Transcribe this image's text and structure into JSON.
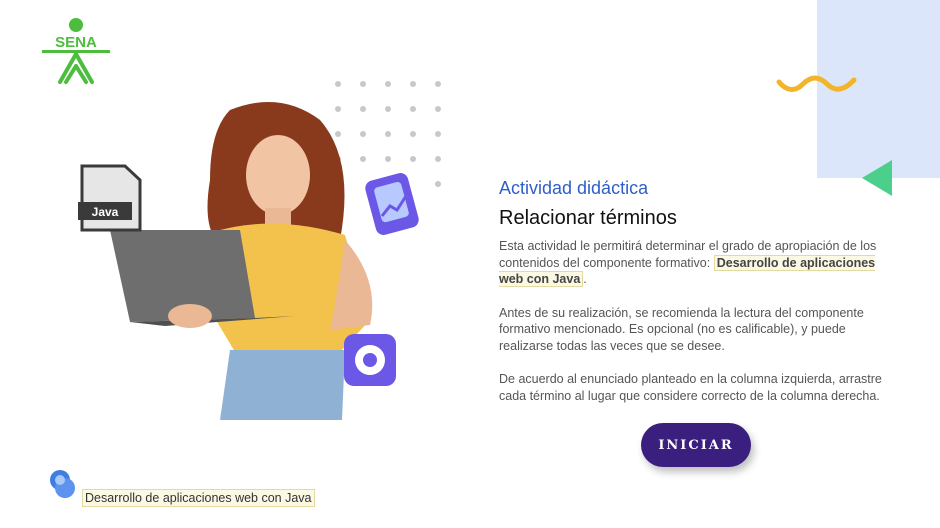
{
  "logo": {
    "text": "SENA",
    "color": "#4dbd3e"
  },
  "activity": {
    "subtitle": "Actividad didáctica",
    "title": "Relacionar términos",
    "p1_before": "Esta actividad le permitirá determinar el grado de apropiación de los contenidos del componente formativo: ",
    "p1_highlight": "Desarrollo de aplicaciones web con Java",
    "p1_after": ".",
    "p2": "Antes de su realización, se recomienda la lectura del componente formativo mencionado.  Es opcional (no es calificable), y puede realizarse todas las veces que se desee.",
    "p3": "De acuerdo al enunciado planteado en la columna izquierda, arrastre cada término al lugar que considere correcto de la columna derecha."
  },
  "start_button": {
    "label": "INICIAR"
  },
  "hero": {
    "java_badge": "Java"
  },
  "footer": {
    "course": "Desarrollo de aplicaciones web con Java"
  },
  "colors": {
    "accent_blue": "#2f5ec7",
    "button_purple": "#3b1f7f",
    "panel_blue": "#dce6fb",
    "wave_yellow": "#f2b42a",
    "triangle_green": "#4ccf8a"
  }
}
